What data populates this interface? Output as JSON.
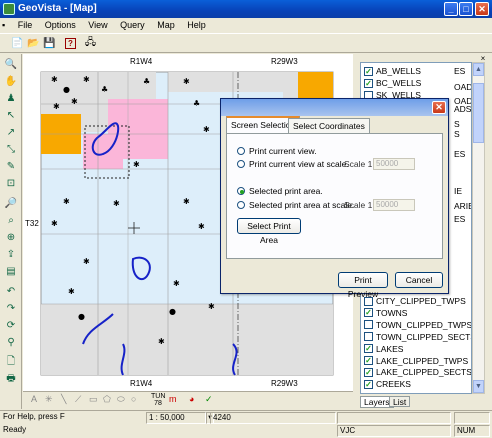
{
  "window": {
    "title": "GeoVista - [Map]"
  },
  "menu": {
    "items": [
      "File",
      "Options",
      "View",
      "Query",
      "Map",
      "Help"
    ]
  },
  "map": {
    "labels": {
      "top_left": "R1W4",
      "top_right": "R29W3",
      "bottom_left": "R1W4",
      "bottom_right": "R29W3",
      "side": "T32"
    }
  },
  "dialog": {
    "tabs": [
      "Screen Selection",
      "Select Coordinates"
    ],
    "options": [
      "Print current view.",
      "Print current view at scale.",
      "Selected print area.",
      "Selected print area at scale."
    ],
    "scale_label": "Scale  1:",
    "scale_value_1": "50000",
    "scale_value_2": "50000",
    "select_button": "Select Print Area",
    "preview_button": "Print Preview",
    "cancel_button": "Cancel",
    "selected_option": 2
  },
  "layers": {
    "items": [
      {
        "label": "AB_WELLS",
        "checked": true
      },
      {
        "label": "BC_WELLS",
        "checked": true
      },
      {
        "label": "SK_WELLS",
        "checked": false
      },
      {
        "label": "CITY_CLIPPED_TWPS",
        "checked": false
      },
      {
        "label": "TOWNS",
        "checked": true
      },
      {
        "label": "TOWN_CLIPPED_TWPS",
        "checked": false
      },
      {
        "label": "TOWN_CLIPPED_SECTS",
        "checked": false
      },
      {
        "label": "LAKES",
        "checked": true
      },
      {
        "label": "LAKE_CLIPPED_TWPS",
        "checked": true
      },
      {
        "label": "LAKE_CLIPPED_SECTS",
        "checked": true
      },
      {
        "label": "CREEKS",
        "checked": true
      }
    ],
    "partial_right": [
      "ES",
      "OADS",
      "OADS",
      "ADS",
      "S",
      "S",
      "ES",
      "IE",
      "ARIES",
      "ES"
    ],
    "tabs": [
      "Layers",
      "List"
    ]
  },
  "toolbar_bottom": {
    "township_label": "TUN 78"
  },
  "status": {
    "help_text": "For Help, press F",
    "scale": "1 : 50,000",
    "coord": "4240",
    "ready": "Ready",
    "vjc": "VJC",
    "num": "NUM"
  }
}
